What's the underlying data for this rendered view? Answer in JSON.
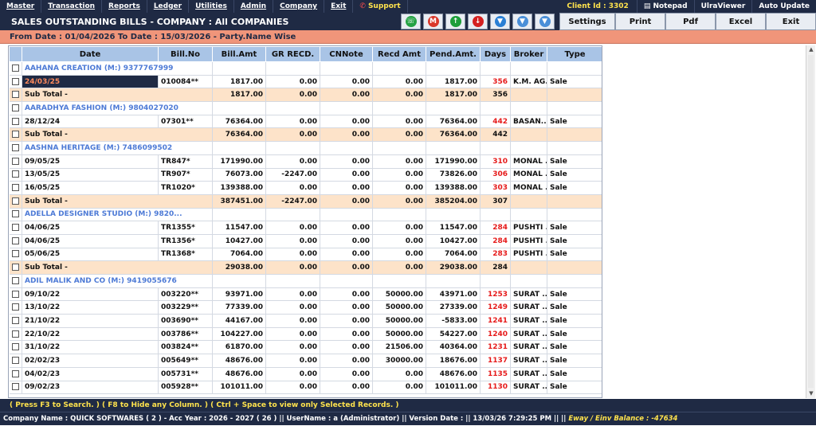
{
  "menu": {
    "left": [
      "Master",
      "Transaction",
      "Reports",
      "Ledger",
      "Utilities",
      "Admin",
      "Company",
      "Exit"
    ],
    "support": "Support",
    "client_id": "Client Id : 3302",
    "right": [
      "Notepad",
      "UlraViewer",
      "Auto Update"
    ]
  },
  "title": "SALES OUTSTANDING BILLS   -  COMPANY : All COMPANIES",
  "icons": [
    {
      "name": "whatsapp-icon",
      "color": "#25a244",
      "glyph": "☏"
    },
    {
      "name": "gmail-icon",
      "color": "#d9372a",
      "glyph": "M"
    },
    {
      "name": "arrow-up-icon",
      "color": "#1e9e3a",
      "glyph": "↑"
    },
    {
      "name": "arrow-down-icon",
      "color": "#d42020",
      "glyph": "↓"
    },
    {
      "name": "filter-icon",
      "color": "#2a7fd4",
      "glyph": "▼"
    },
    {
      "name": "filter-add-icon",
      "color": "#4a8fd8",
      "glyph": "▼"
    },
    {
      "name": "filter-remove-icon",
      "color": "#4a8fd8",
      "glyph": "▼"
    }
  ],
  "buttons": {
    "settings": "Settings",
    "print": "Print",
    "pdf": "Pdf",
    "excel": "Excel",
    "exit": "Exit"
  },
  "subtitle": "From Date : 01/04/2026 To Date : 15/03/2026 - Party.Name Wise",
  "table": {
    "headers": [
      "",
      "Date",
      "Bill.No",
      "Bill.Amt",
      "GR RECD.",
      "CNNote",
      "Recd Amt",
      "Pend.Amt.",
      "Days",
      "Broker",
      "Type"
    ],
    "rows": [
      {
        "kind": "party",
        "name": "AAHANA CREATION (M:) 9377767999"
      },
      {
        "kind": "bill",
        "sel": true,
        "date": "24/03/25",
        "bill": "010084**",
        "amt": "1817.00",
        "gr": "0.00",
        "cn": "0.00",
        "recd": "0.00",
        "pend": "1817.00",
        "days": "356",
        "broker": "K.M. AG...",
        "type": "Sale"
      },
      {
        "kind": "sub",
        "label": "Sub Total -",
        "amt": "1817.00",
        "gr": "0.00",
        "cn": "0.00",
        "recd": "0.00",
        "pend": "1817.00",
        "days": "356"
      },
      {
        "kind": "party",
        "name": "AARADHYA FASHION (M:) 9804027020"
      },
      {
        "kind": "bill",
        "date": "28/12/24",
        "bill": "07301**",
        "amt": "76364.00",
        "gr": "0.00",
        "cn": "0.00",
        "recd": "0.00",
        "pend": "76364.00",
        "days": "442",
        "broker": "BASAN...",
        "type": "Sale"
      },
      {
        "kind": "sub",
        "label": "Sub Total -",
        "amt": "76364.00",
        "gr": "0.00",
        "cn": "0.00",
        "recd": "0.00",
        "pend": "76364.00",
        "days": "442"
      },
      {
        "kind": "party",
        "name": "AASHNA HERITAGE (M:) 7486099502"
      },
      {
        "kind": "bill",
        "date": "09/05/25",
        "bill": "TR847*",
        "amt": "171990.00",
        "gr": "0.00",
        "cn": "0.00",
        "recd": "0.00",
        "pend": "171990.00",
        "days": "310",
        "broker": "MONAL ...",
        "type": "Sale"
      },
      {
        "kind": "bill",
        "date": "13/05/25",
        "bill": "TR907*",
        "amt": "76073.00",
        "gr": "-2247.00",
        "cn": "0.00",
        "recd": "0.00",
        "pend": "73826.00",
        "days": "306",
        "broker": "MONAL ...",
        "type": "Sale"
      },
      {
        "kind": "bill",
        "date": "16/05/25",
        "bill": "TR1020*",
        "amt": "139388.00",
        "gr": "0.00",
        "cn": "0.00",
        "recd": "0.00",
        "pend": "139388.00",
        "days": "303",
        "broker": "MONAL ...",
        "type": "Sale"
      },
      {
        "kind": "sub",
        "label": "Sub Total -",
        "amt": "387451.00",
        "gr": "-2247.00",
        "cn": "0.00",
        "recd": "0.00",
        "pend": "385204.00",
        "days": "307"
      },
      {
        "kind": "party",
        "name": "ADELLA DESIGNER STUDIO (M:) 9820..."
      },
      {
        "kind": "bill",
        "date": "04/06/25",
        "bill": "TR1355*",
        "amt": "11547.00",
        "gr": "0.00",
        "cn": "0.00",
        "recd": "0.00",
        "pend": "11547.00",
        "days": "284",
        "broker": "PUSHTI ...",
        "type": "Sale"
      },
      {
        "kind": "bill",
        "date": "04/06/25",
        "bill": "TR1356*",
        "amt": "10427.00",
        "gr": "0.00",
        "cn": "0.00",
        "recd": "0.00",
        "pend": "10427.00",
        "days": "284",
        "broker": "PUSHTI ...",
        "type": "Sale"
      },
      {
        "kind": "bill",
        "date": "05/06/25",
        "bill": "TR1368*",
        "amt": "7064.00",
        "gr": "0.00",
        "cn": "0.00",
        "recd": "0.00",
        "pend": "7064.00",
        "days": "283",
        "broker": "PUSHTI ...",
        "type": "Sale"
      },
      {
        "kind": "sub",
        "label": "Sub Total -",
        "amt": "29038.00",
        "gr": "0.00",
        "cn": "0.00",
        "recd": "0.00",
        "pend": "29038.00",
        "days": "284"
      },
      {
        "kind": "party",
        "name": "ADIL MALIK AND CO (M:) 9419055676"
      },
      {
        "kind": "bill",
        "date": "09/10/22",
        "bill": "003220**",
        "amt": "93971.00",
        "gr": "0.00",
        "cn": "0.00",
        "recd": "50000.00",
        "pend": "43971.00",
        "days": "1253",
        "broker": "SURAT ...",
        "type": "Sale"
      },
      {
        "kind": "bill",
        "date": "13/10/22",
        "bill": "003229**",
        "amt": "77339.00",
        "gr": "0.00",
        "cn": "0.00",
        "recd": "50000.00",
        "pend": "27339.00",
        "days": "1249",
        "broker": "SURAT ...",
        "type": "Sale"
      },
      {
        "kind": "bill",
        "date": "21/10/22",
        "bill": "003690**",
        "amt": "44167.00",
        "gr": "0.00",
        "cn": "0.00",
        "recd": "50000.00",
        "pend": "-5833.00",
        "days": "1241",
        "broker": "SURAT ...",
        "type": "Sale"
      },
      {
        "kind": "bill",
        "date": "22/10/22",
        "bill": "003786**",
        "amt": "104227.00",
        "gr": "0.00",
        "cn": "0.00",
        "recd": "50000.00",
        "pend": "54227.00",
        "days": "1240",
        "broker": "SURAT ...",
        "type": "Sale"
      },
      {
        "kind": "bill",
        "date": "31/10/22",
        "bill": "003824**",
        "amt": "61870.00",
        "gr": "0.00",
        "cn": "0.00",
        "recd": "21506.00",
        "pend": "40364.00",
        "days": "1231",
        "broker": "SURAT ...",
        "type": "Sale"
      },
      {
        "kind": "bill",
        "date": "02/02/23",
        "bill": "005649**",
        "amt": "48676.00",
        "gr": "0.00",
        "cn": "0.00",
        "recd": "30000.00",
        "pend": "18676.00",
        "days": "1137",
        "broker": "SURAT ...",
        "type": "Sale"
      },
      {
        "kind": "bill",
        "date": "04/02/23",
        "bill": "005731**",
        "amt": "48676.00",
        "gr": "0.00",
        "cn": "0.00",
        "recd": "0.00",
        "pend": "48676.00",
        "days": "1135",
        "broker": "SURAT ...",
        "type": "Sale"
      },
      {
        "kind": "bill",
        "date": "09/02/23",
        "bill": "005928**",
        "amt": "101011.00",
        "gr": "0.00",
        "cn": "0.00",
        "recd": "0.00",
        "pend": "101011.00",
        "days": "1130",
        "broker": "SURAT ...",
        "type": "Sale"
      }
    ]
  },
  "hint": "( Press F3 to Search. )    ( F8 to Hide any Column. )    ( Ctrl + Space to view only Selected Records. )",
  "status": {
    "main": "Company Name : QUICK SOFTWARES ( 2 )  -  Acc Year : 2026 - 2027 ( 26 )      ||   UserName : a (Administrator)  ||  Version Date :  ||  13/03/26 7:29:25 PM      ||      ||",
    "eway": "Eway / Einv Balance : -47634"
  }
}
